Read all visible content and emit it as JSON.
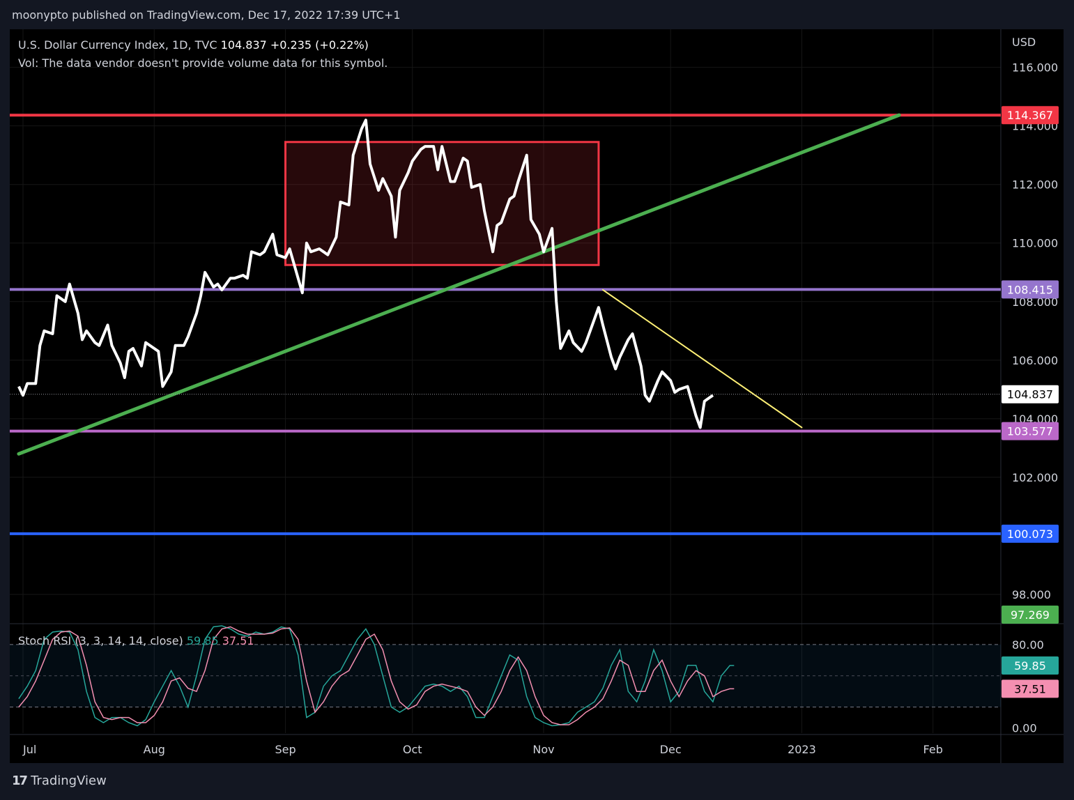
{
  "header": {
    "published": "moonypto published on TradingView.com, Dec 17, 2022 17:39 UTC+1"
  },
  "legend": {
    "symbol": "U.S. Dollar Currency Index, 1D, TVC",
    "price": "104.837",
    "change": "+0.235 (+0.22%)",
    "volume_note": "Vol: The data vendor doesn't provide volume data for this symbol."
  },
  "currency": "USD",
  "stoch_legend": {
    "label": "Stoch RSI (3, 3, 14, 14, close)",
    "k": "59.85",
    "d": "37.51"
  },
  "footer": {
    "brand": "TradingView",
    "logo_glyph": "17"
  },
  "colors": {
    "background": "#000000",
    "price_line": "#ffffff",
    "resistance": "#f23645",
    "upper_support": "#9575cd",
    "lower_support": "#ba68c8",
    "blue_level": "#2962ff",
    "trendline": "#4caf50",
    "down_trendline": "#fff176",
    "box": "#f23645",
    "stoch_k": "#26a69a",
    "stoch_d": "#f48fb1"
  },
  "chart_data": [
    {
      "type": "line",
      "title": "U.S. Dollar Currency Index, 1D, TVC",
      "ylim": [
        97.0,
        117.3
      ],
      "y_ticks": [
        "116.000",
        "114.000",
        "112.000",
        "110.000",
        "108.000",
        "106.000",
        "104.000",
        "102.000",
        "98.000"
      ],
      "x_ticks": [
        "Jul",
        "Aug",
        "Sep",
        "Oct",
        "Nov",
        "Dec",
        "2023",
        "Feb"
      ],
      "x_tick_dates": [
        "2022-07-01",
        "2022-08-01",
        "2022-09-01",
        "2022-10-01",
        "2022-11-01",
        "2022-12-01",
        "2023-01-01",
        "2023-02-01"
      ],
      "price": {
        "name": "DXY close",
        "x": [
          "2022-06-30",
          "2022-07-01",
          "2022-07-02",
          "2022-07-04",
          "2022-07-05",
          "2022-07-06",
          "2022-07-08",
          "2022-07-09",
          "2022-07-11",
          "2022-07-12",
          "2022-07-14",
          "2022-07-15",
          "2022-07-16",
          "2022-07-18",
          "2022-07-19",
          "2022-07-21",
          "2022-07-22",
          "2022-07-24",
          "2022-07-25",
          "2022-07-26",
          "2022-07-27",
          "2022-07-29",
          "2022-07-30",
          "2022-08-01",
          "2022-08-02",
          "2022-08-03",
          "2022-08-05",
          "2022-08-06",
          "2022-08-08",
          "2022-08-09",
          "2022-08-11",
          "2022-08-12",
          "2022-08-13",
          "2022-08-15",
          "2022-08-16",
          "2022-08-17",
          "2022-08-19",
          "2022-08-20",
          "2022-08-22",
          "2022-08-23",
          "2022-08-24",
          "2022-08-26",
          "2022-08-27",
          "2022-08-29",
          "2022-08-30",
          "2022-09-01",
          "2022-09-02",
          "2022-09-04",
          "2022-09-05",
          "2022-09-06",
          "2022-09-07",
          "2022-09-09",
          "2022-09-10",
          "2022-09-11",
          "2022-09-13",
          "2022-09-14",
          "2022-09-16",
          "2022-09-17",
          "2022-09-19",
          "2022-09-20",
          "2022-09-21",
          "2022-09-23",
          "2022-09-24",
          "2022-09-26",
          "2022-09-27",
          "2022-09-28",
          "2022-09-30",
          "2022-10-01",
          "2022-10-03",
          "2022-10-04",
          "2022-10-06",
          "2022-10-07",
          "2022-10-08",
          "2022-10-10",
          "2022-10-11",
          "2022-10-13",
          "2022-10-14",
          "2022-10-15",
          "2022-10-17",
          "2022-10-18",
          "2022-10-20",
          "2022-10-21",
          "2022-10-22",
          "2022-10-24",
          "2022-10-25",
          "2022-10-26",
          "2022-10-28",
          "2022-10-29",
          "2022-10-31",
          "2022-11-01",
          "2022-11-03",
          "2022-11-04",
          "2022-11-05",
          "2022-11-07",
          "2022-11-08",
          "2022-11-10",
          "2022-11-11",
          "2022-11-12",
          "2022-11-14",
          "2022-11-15",
          "2022-11-17",
          "2022-11-18",
          "2022-11-19",
          "2022-11-21",
          "2022-11-22",
          "2022-11-24",
          "2022-11-25",
          "2022-11-26",
          "2022-11-28",
          "2022-11-29",
          "2022-12-01",
          "2022-12-02",
          "2022-12-03",
          "2022-12-05",
          "2022-12-07",
          "2022-12-08",
          "2022-12-09",
          "2022-12-11",
          "2022-12-12",
          "2022-12-14",
          "2022-12-15",
          "2022-12-16"
        ],
        "values": [
          105.1,
          104.8,
          105.2,
          105.2,
          106.5,
          107.0,
          106.9,
          108.2,
          108.0,
          108.6,
          107.6,
          106.7,
          107.0,
          106.6,
          106.5,
          107.2,
          106.5,
          105.9,
          105.4,
          106.3,
          106.4,
          105.8,
          106.6,
          106.4,
          106.3,
          105.1,
          105.6,
          106.5,
          106.5,
          106.8,
          107.6,
          108.2,
          109.0,
          108.5,
          108.6,
          108.4,
          108.8,
          108.8,
          108.9,
          108.8,
          109.7,
          109.6,
          109.7,
          110.3,
          109.6,
          109.5,
          109.8,
          108.8,
          108.3,
          110.0,
          109.7,
          109.8,
          109.7,
          109.6,
          110.2,
          111.4,
          111.3,
          113.0,
          113.9,
          114.2,
          112.7,
          111.8,
          112.2,
          111.6,
          110.2,
          111.8,
          112.4,
          112.8,
          113.2,
          113.3,
          113.3,
          112.5,
          113.3,
          112.1,
          112.1,
          112.9,
          112.8,
          111.9,
          112.0,
          111.1,
          109.7,
          110.6,
          110.7,
          111.5,
          111.6,
          112.1,
          113.0,
          110.8,
          110.3,
          109.7,
          110.5,
          108.0,
          106.4,
          107.0,
          106.6,
          106.3,
          106.6,
          107.0,
          107.8,
          107.2,
          106.1,
          105.7,
          106.1,
          106.7,
          106.9,
          105.8,
          104.8,
          104.6,
          105.3,
          105.6,
          105.3,
          104.9,
          105.0,
          105.1,
          104.1,
          103.7,
          104.6,
          104.8
        ]
      },
      "horizontal_levels": [
        {
          "value": 114.367,
          "label": "114.367",
          "color": "#f23645",
          "width": 4
        },
        {
          "value": 108.415,
          "label": "108.415",
          "color": "#9575cd",
          "width": 4
        },
        {
          "value": 103.577,
          "label": "103.577",
          "color": "#ba68c8",
          "width": 4
        },
        {
          "value": 100.073,
          "label": "100.073",
          "color": "#2962ff",
          "width": 4
        }
      ],
      "last_price": {
        "value": 104.837,
        "label": "104.837"
      },
      "green_level_label": "97.269",
      "trendlines": [
        {
          "name": "rising trendline",
          "color": "#4caf50",
          "from": {
            "x": "2022-06-30",
            "y": 102.8
          },
          "to": {
            "x": "2023-01-24",
            "y": 114.37
          }
        },
        {
          "name": "falling trendline",
          "color": "#fff176",
          "from": {
            "x": "2022-11-15",
            "y": 108.4
          },
          "to": {
            "x": "2023-01-01",
            "y": 103.7
          }
        }
      ],
      "range_box": {
        "x_start": "2022-09-01",
        "x_end": "2022-11-14",
        "y_top": 113.45,
        "y_bottom": 109.25
      }
    },
    {
      "type": "line",
      "title": "Stoch RSI (3, 3, 14, 14, close)",
      "ylim": [
        -5,
        100
      ],
      "y_ticks": [
        "80.00",
        "0.00"
      ],
      "band": [
        20,
        80
      ],
      "mid": 50,
      "x": [
        "2022-06-30",
        "2022-07-02",
        "2022-07-04",
        "2022-07-06",
        "2022-07-08",
        "2022-07-10",
        "2022-07-12",
        "2022-07-14",
        "2022-07-16",
        "2022-07-18",
        "2022-07-20",
        "2022-07-22",
        "2022-07-24",
        "2022-07-26",
        "2022-07-28",
        "2022-07-30",
        "2022-08-01",
        "2022-08-03",
        "2022-08-05",
        "2022-08-07",
        "2022-08-09",
        "2022-08-11",
        "2022-08-13",
        "2022-08-15",
        "2022-08-17",
        "2022-08-19",
        "2022-08-21",
        "2022-08-23",
        "2022-08-25",
        "2022-08-27",
        "2022-08-29",
        "2022-08-31",
        "2022-09-02",
        "2022-09-04",
        "2022-09-06",
        "2022-09-08",
        "2022-09-10",
        "2022-09-12",
        "2022-09-14",
        "2022-09-16",
        "2022-09-18",
        "2022-09-20",
        "2022-09-22",
        "2022-09-24",
        "2022-09-26",
        "2022-09-28",
        "2022-09-30",
        "2022-10-02",
        "2022-10-04",
        "2022-10-06",
        "2022-10-08",
        "2022-10-10",
        "2022-10-12",
        "2022-10-14",
        "2022-10-16",
        "2022-10-18",
        "2022-10-20",
        "2022-10-22",
        "2022-10-24",
        "2022-10-26",
        "2022-10-28",
        "2022-10-30",
        "2022-11-01",
        "2022-11-03",
        "2022-11-05",
        "2022-11-07",
        "2022-11-09",
        "2022-11-11",
        "2022-11-13",
        "2022-11-15",
        "2022-11-17",
        "2022-11-19",
        "2022-11-21",
        "2022-11-23",
        "2022-11-25",
        "2022-11-27",
        "2022-11-29",
        "2022-12-01",
        "2022-12-03",
        "2022-12-05",
        "2022-12-07",
        "2022-12-09",
        "2022-12-11",
        "2022-12-13",
        "2022-12-15",
        "2022-12-16"
      ],
      "series": [
        {
          "name": "K",
          "values": [
            28,
            40,
            55,
            85,
            92,
            93,
            92,
            75,
            35,
            10,
            5,
            10,
            10,
            5,
            2,
            8,
            25,
            40,
            55,
            40,
            20,
            50,
            85,
            97,
            98,
            95,
            90,
            88,
            92,
            90,
            92,
            97,
            95,
            70,
            10,
            15,
            40,
            50,
            55,
            70,
            85,
            95,
            80,
            50,
            20,
            15,
            20,
            30,
            40,
            42,
            40,
            35,
            40,
            30,
            10,
            10,
            30,
            50,
            70,
            65,
            30,
            10,
            5,
            2,
            3,
            5,
            15,
            20,
            25,
            38,
            60,
            75,
            35,
            25,
            45,
            75,
            55,
            25,
            35,
            60,
            60,
            35,
            25,
            50,
            59.85,
            59.85
          ]
        },
        {
          "name": "D",
          "values": [
            20,
            30,
            45,
            65,
            85,
            92,
            93,
            88,
            60,
            25,
            10,
            8,
            10,
            10,
            5,
            5,
            12,
            25,
            45,
            48,
            38,
            35,
            55,
            85,
            95,
            97,
            93,
            90,
            90,
            90,
            91,
            95,
            96,
            85,
            45,
            15,
            25,
            40,
            50,
            55,
            70,
            85,
            90,
            75,
            45,
            25,
            18,
            22,
            35,
            40,
            42,
            40,
            38,
            35,
            20,
            12,
            20,
            35,
            55,
            68,
            55,
            30,
            12,
            5,
            3,
            3,
            8,
            15,
            20,
            28,
            45,
            65,
            60,
            35,
            35,
            55,
            65,
            45,
            30,
            45,
            55,
            50,
            30,
            35,
            37.51,
            37.51
          ]
        }
      ]
    }
  ]
}
